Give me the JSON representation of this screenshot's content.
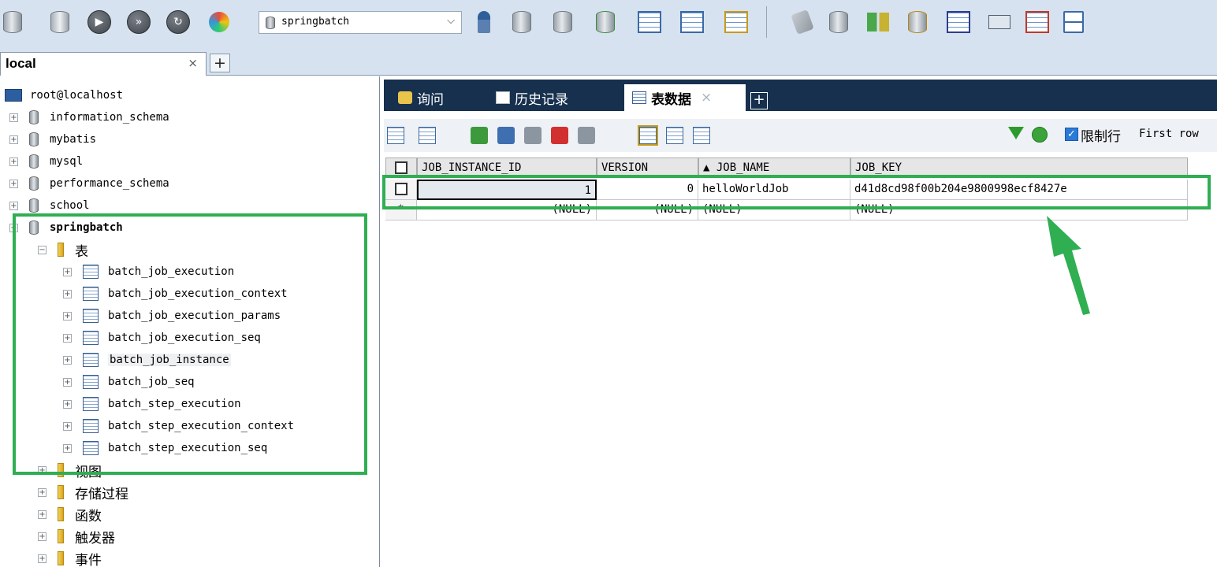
{
  "toolbar": {
    "database_select": {
      "value": "springbatch"
    },
    "left_icons": [
      "new-connection-icon",
      "add-user-icon",
      "play-icon",
      "fast-forward-icon",
      "refresh-icon",
      "colors-icon"
    ],
    "right_icons": [
      "user-icon",
      "database-down-icon",
      "database-up-icon",
      "database-export-icon",
      "table-import-icon",
      "table-list-icon",
      "table-edit-icon",
      "tools-icon",
      "database-settings-icon",
      "compare-icon",
      "transfer-icon",
      "schema-designer-icon",
      "keyboard-icon",
      "table-report-icon",
      "structure-sync-icon"
    ]
  },
  "connection_tab": {
    "label": "local",
    "close": "×",
    "add": "+"
  },
  "tree": {
    "root": "root@localhost",
    "databases": [
      {
        "name": "information_schema"
      },
      {
        "name": "mybatis"
      },
      {
        "name": "mysql"
      },
      {
        "name": "performance_schema"
      },
      {
        "name": "school"
      },
      {
        "name": "springbatch"
      }
    ],
    "tables_folder": "表",
    "tables": [
      "batch_job_execution",
      "batch_job_execution_context",
      "batch_job_execution_params",
      "batch_job_execution_seq",
      "batch_job_instance",
      "batch_job_seq",
      "batch_step_execution",
      "batch_step_execution_context",
      "batch_step_execution_seq"
    ],
    "folders": [
      "视图",
      "存储过程",
      "函数",
      "触发器",
      "事件"
    ]
  },
  "tabs": [
    {
      "label": "询问"
    },
    {
      "label": "历史记录"
    },
    {
      "label": "表数据",
      "close": "×"
    }
  ],
  "tab_add": "+",
  "gridbar": {
    "limit_label": "限制行",
    "limit_checked": true,
    "first_row_text": "First row"
  },
  "grid": {
    "columns": [
      "JOB_INSTANCE_ID",
      "VERSION",
      "▲ JOB_NAME",
      "JOB_KEY"
    ],
    "rows": [
      [
        "1",
        "0",
        "helloWorldJob",
        "d41d8cd98f00b204e9800998ecf8427e"
      ],
      [
        "(NULL)",
        "(NULL)",
        "(NULL)",
        "(NULL)"
      ]
    ],
    "new_row_marker": "*"
  },
  "colors": {
    "highlight": "#2fae52",
    "tabbar": "#16304e",
    "toolbar": "#d6e2ef"
  }
}
